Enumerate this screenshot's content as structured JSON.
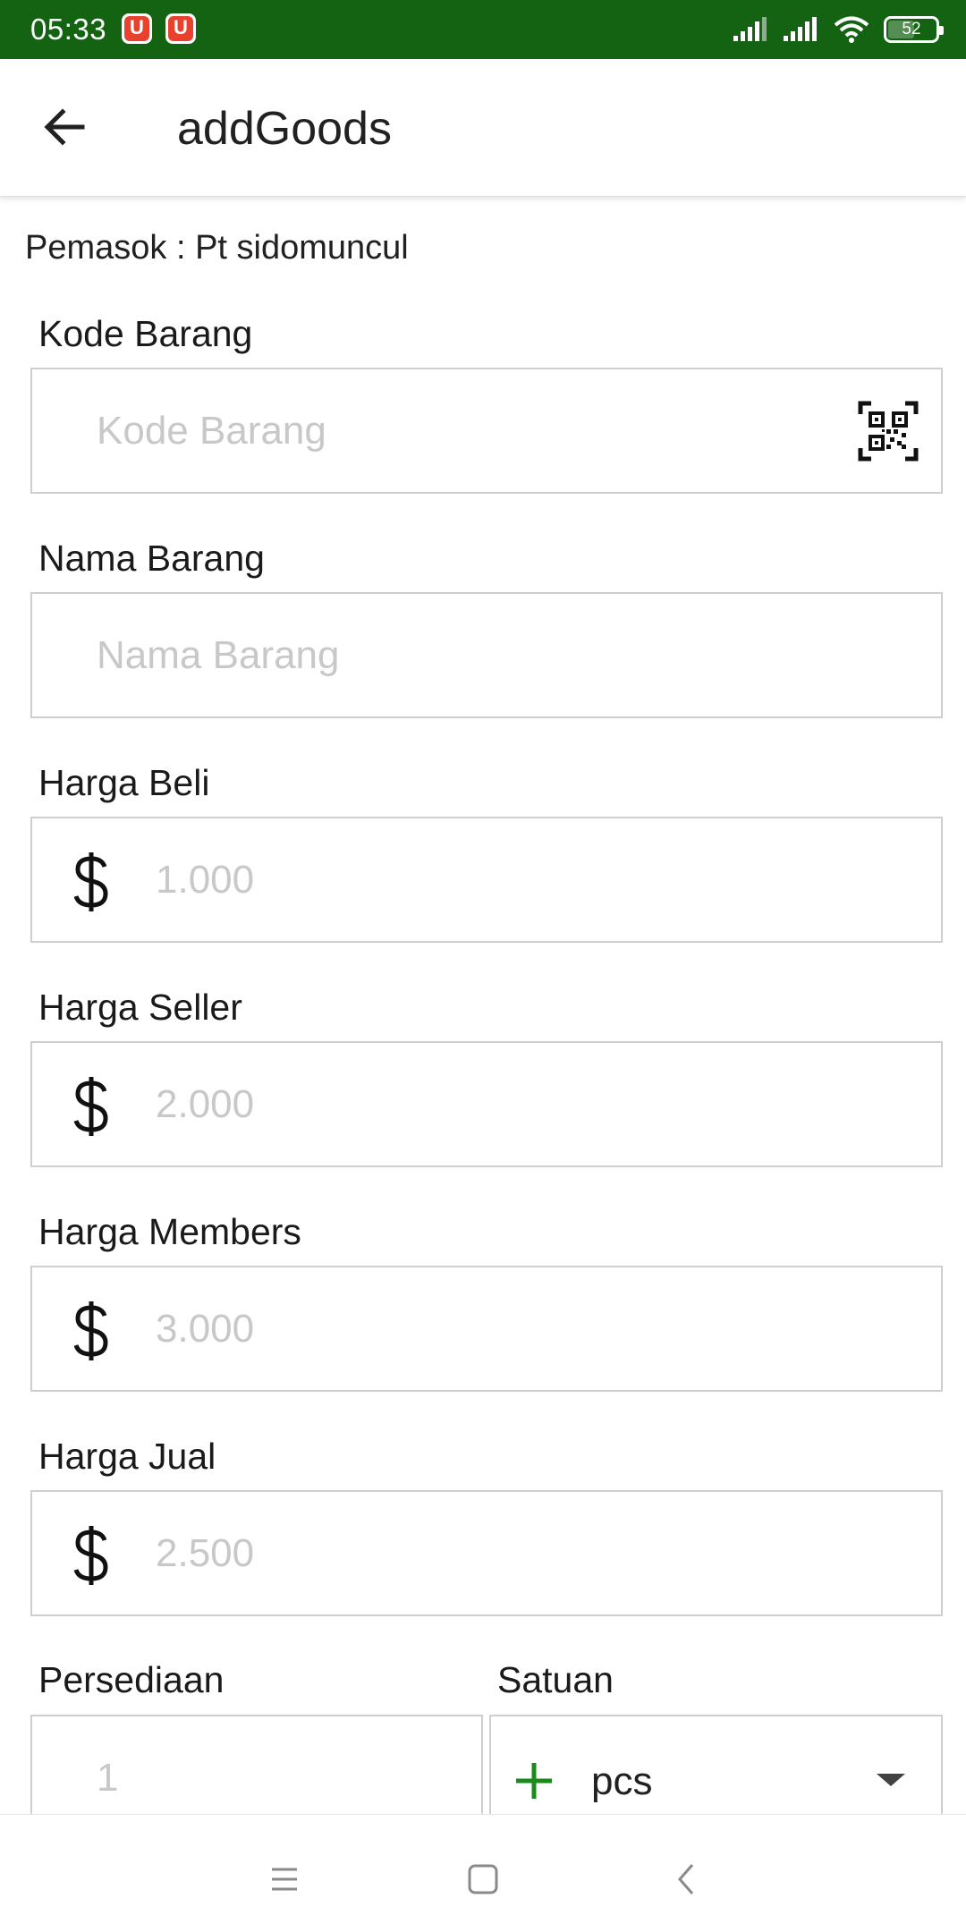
{
  "status_bar": {
    "time": "05:33",
    "notification_icons": [
      "U",
      "U"
    ],
    "battery_level": "52",
    "icons": [
      "signal-icon",
      "signal-icon",
      "wifi-icon",
      "battery-icon"
    ]
  },
  "app_bar": {
    "title": "addGoods",
    "back_icon": "arrow-back-icon"
  },
  "supplier_text": "Pemasok : Pt sidomuncul",
  "fields": {
    "kode_barang": {
      "label": "Kode Barang",
      "placeholder": "Kode Barang",
      "icon": "qr-code-icon"
    },
    "nama_barang": {
      "label": "Nama Barang",
      "placeholder": "Nama Barang"
    },
    "harga_beli": {
      "label": "Harga Beli",
      "placeholder": "1.000",
      "icon": "dollar-icon"
    },
    "harga_seller": {
      "label": "Harga Seller",
      "placeholder": "2.000",
      "icon": "dollar-icon"
    },
    "harga_members": {
      "label": "Harga Members",
      "placeholder": "3.000",
      "icon": "dollar-icon"
    },
    "harga_jual": {
      "label": "Harga Jual",
      "placeholder": "2.500",
      "icon": "dollar-icon"
    },
    "persediaan": {
      "label": "Persediaan",
      "placeholder": "1"
    },
    "satuan": {
      "label": "Satuan",
      "selected": "pcs",
      "add_icon": "plus-icon",
      "dropdown_icon": "chevron-down-icon"
    }
  },
  "nav_bar": {
    "icons": [
      "menu-icon",
      "home-icon",
      "back-icon"
    ]
  },
  "colors": {
    "status_bar": "#136312",
    "accent_green": "#1b8a1b",
    "border": "#cfcfcf",
    "placeholder": "#c8c8c8"
  }
}
